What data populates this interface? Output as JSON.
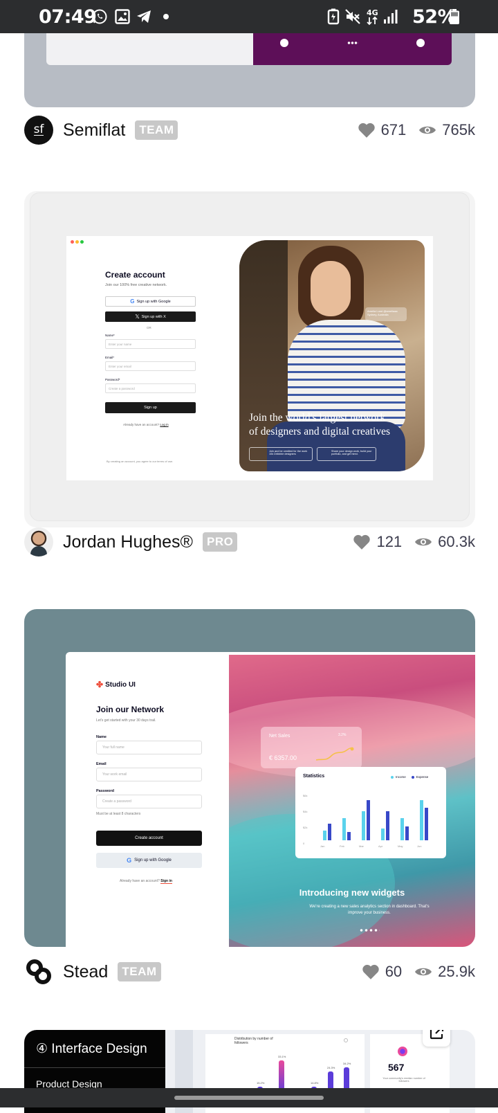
{
  "status_bar": {
    "time": "07:49",
    "battery_percent": "52%",
    "network": "4G",
    "icons_left": [
      "whatsapp-icon",
      "gallery-icon",
      "telegram-icon",
      "dot-icon"
    ],
    "icons_right": [
      "battery-saver-icon",
      "mute-icon",
      "network-4g-icon",
      "signal-icon",
      "battery-icon"
    ]
  },
  "shots": [
    {
      "author": "Semiflat",
      "avatar_text": "sf",
      "badge": "TEAM",
      "likes": "671",
      "views": "765k"
    },
    {
      "author": "Jordan Hughes®",
      "badge": "PRO",
      "likes": "121",
      "views": "60.3k",
      "preview": {
        "title": "Create account",
        "subtitle": "Join our 100% free creative network.",
        "google_btn": "Sign up with Google",
        "x_btn": "Sign up with X",
        "or": "OR",
        "name_label": "Name*",
        "name_ph": "Enter your name",
        "email_label": "Email*",
        "email_ph": "Enter your email",
        "password_label": "Password*",
        "password_ph": "Create a password",
        "signup_btn": "Sign up",
        "already": "Already have an account?",
        "login": "Log in",
        "terms": "By creating an account, you agree to our terms of use.",
        "tag_name": "Amelia Lund @ameliaaa",
        "tag_loc": "Sydney, Australia",
        "hero_line1": "Join the world's largest network",
        "hero_line2": "of designers and digital creatives",
        "feature1": "Join and be credited for the work 10k Dribbble designers",
        "feature2": "Share your design work, build your portfolio, and get hired."
      }
    },
    {
      "author": "Stead",
      "badge": "TEAM",
      "likes": "60",
      "views": "25.9k",
      "preview": {
        "brand": "Studio UI",
        "title": "Join our Network",
        "subtitle": "Let's get started with your 30 days trail.",
        "name_label": "Name",
        "name_ph": "Your full name",
        "email_label": "Email",
        "email_ph": "Your work email",
        "password_label": "Password",
        "password_ph": "Create a password",
        "hint": "Must be at least 8 characters",
        "create_btn": "Create account",
        "google_btn": "Sign up with Google",
        "already": "Already have an account?",
        "signin": "Sign in",
        "net_sales_label": "Net Sales",
        "net_sales_change": "3.2%",
        "net_sales_value": "€ 6357.00",
        "stats_title": "Statistics",
        "legend_income": "Income",
        "legend_expense": "Expense",
        "y_ticks": [
          "$6k",
          "$4k",
          "$2k",
          "0"
        ],
        "months": [
          "Jan",
          "Feb",
          "Mar",
          "Apr",
          "May",
          "Jun"
        ],
        "headline": "Introducing new widgets",
        "body": "We're creating a new sales analytics section in dashboard. That's improve your business."
      }
    },
    {
      "preview": {
        "menu_item1": "④ Interface Design",
        "menu_item2": "Product Design",
        "chart_title": "Distribution by number of followers",
        "bar_labels": [
          "15.2%",
          "33.1%",
          "14.8%",
          "24.3%",
          "34.2%"
        ],
        "big_number": "567",
        "big_caption": "Your community's median number of followers"
      }
    }
  ],
  "colors": {
    "status_bar": "#2c2d2f",
    "card1_bg": "#b7bcc4",
    "card1_purple": "#5d0f58",
    "card2_bg": "#f1f1f1",
    "card3_bg": "#6e8990",
    "badge_bg": "#c8c8c8",
    "stat_icon": "#868686"
  }
}
